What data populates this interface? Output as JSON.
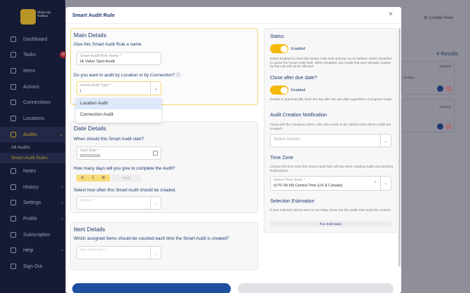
{
  "sidebar": {
    "logo_text": "Share My Toolbox",
    "tasks_badge": "18",
    "items": [
      "Dashboard",
      "Tasks",
      "Items",
      "Actions",
      "Connections",
      "Locations",
      "Audits",
      "Notes",
      "History",
      "Settings",
      "Profile",
      "Subscription",
      "Help",
      "Sign Out"
    ],
    "audits_sub": [
      "All Audits",
      "Smart Audit Rules"
    ]
  },
  "background": {
    "create_rule": "Create Rule",
    "results": "4 Results",
    "card1_status": "Enabled",
    "card1_text": "14 days",
    "card2_status": "Enabled"
  },
  "modal": {
    "title": "Smart Audit Rule",
    "close": "×",
    "main": {
      "heading": "Main Details",
      "name_q": "Give this Smart Audit Rule a name.",
      "name_label": "Smart Audit Rule Name *",
      "name_value": "Hi Value Spot Audit",
      "type_q": "Do you want to audit by Location or by Connection?",
      "type_label": "Select Audit Type *",
      "type_value": "|",
      "options": [
        "Location Audit",
        "Connection Audit"
      ]
    },
    "dates": {
      "heading": "Date Details",
      "start_q": "When should this Smart Audit start?",
      "start_label": "Start Date *",
      "start_value": "02/23/2026",
      "days_q": "How many days will you give to complete the Audit?",
      "days_value": "1",
      "days_unit": "day(s)",
      "repeat_q": "Select how often this Smart Audit should be created.",
      "repeat_label": "Repeat *"
    },
    "items": {
      "heading": "Item Details",
      "q": "Which assigned Items should be counted each time the Smart Audit is created?",
      "label": "Item Selection *"
    },
    "status": {
      "heading": "Status",
      "toggle": "Enabled",
      "note": "Select Enabled to have this Smart Audit Rule actively run as defined. Select Disabled to pause the Smart Audit Rule. When Disabled, any Audits that were already created by this rule will not be affected."
    },
    "close_after": {
      "heading": "Close after due date?",
      "toggle": "Enabled",
      "note": "Enable to automatically close the day after the due date regardless of progress made."
    },
    "notify": {
      "heading": "Audit Creation Notification",
      "note": "Along with the Company Admin, who else needs to be notified when these Audits are created?",
      "placeholder": "Select Admins"
    },
    "timezone": {
      "heading": "Time Zone",
      "note": "Choose the time zone this Smart Audit Rule will use when creating Audits and sending Notifications.",
      "label": "Select Time Zone *",
      "value": "(UTC-06:00) Central Time (US & Canada)",
      "clear": "×"
    },
    "estimation": {
      "heading": "Selection Estimation",
      "note": "If your selected criteria were to run today, these are the audits that would be created:",
      "button": "Run Estimation"
    }
  },
  "colors": {
    "navy": "#151a35",
    "accent": "#f5b90a",
    "heading": "#1f3b6e",
    "primary": "#1d4fa0"
  }
}
